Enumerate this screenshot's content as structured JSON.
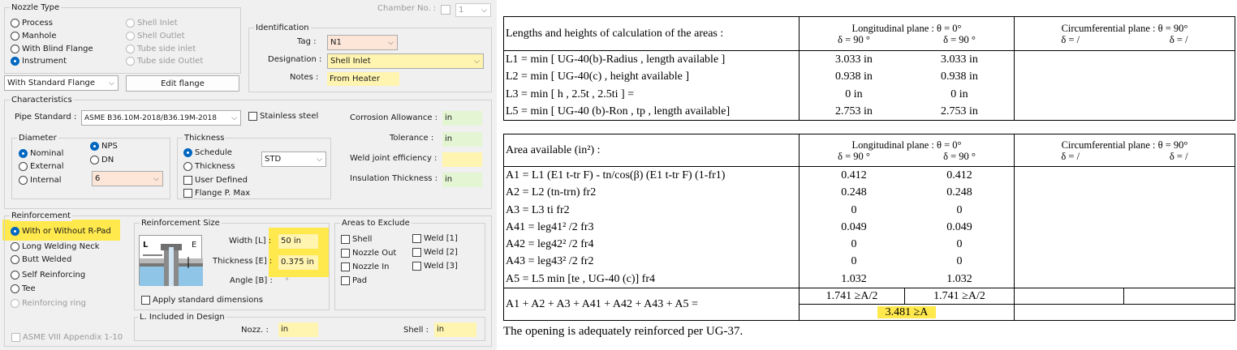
{
  "nozzle_type": {
    "title": "Nozzle Type",
    "options": [
      "Process",
      "Manhole",
      "With Blind Flange",
      "Instrument"
    ],
    "selected": "Instrument",
    "disabled_options": [
      "Shell Inlet",
      "Shell Outlet",
      "Tube side inlet",
      "Tube side Outlet"
    ]
  },
  "chamber": {
    "label": "Chamber No. :",
    "value": "1"
  },
  "identification": {
    "title": "Identification",
    "tag_label": "Tag :",
    "tag_value": "N1",
    "designation_label": "Designation :",
    "designation_value": "Shell Inlet",
    "notes_label": "Notes :",
    "notes_value": "From Heater"
  },
  "flange": {
    "select_value": "With Standard Flange",
    "edit_button": "Edit flange"
  },
  "characteristics": {
    "title": "Characteristics",
    "pipe_standard_label": "Pipe Standard :",
    "pipe_standard_value": "ASME B36.10M-2018/B36.19M-2018",
    "stainless_label": "Stainless steel",
    "corrosion_label": "Corrosion Allowance :",
    "corrosion_value": "in",
    "tolerance_label": "Tolerance :",
    "tolerance_value": "in",
    "weld_eff_label": "Weld joint efficiency :",
    "weld_eff_value": "",
    "insulation_label": "Insulation Thickness :",
    "insulation_value": "in"
  },
  "diameter": {
    "title": "Diameter",
    "options": [
      "Nominal",
      "External",
      "Internal"
    ],
    "selected": "Nominal",
    "unit_options": [
      "NPS",
      "DN"
    ],
    "unit_selected": "NPS",
    "size_value": "6"
  },
  "thickness": {
    "title": "Thickness",
    "options": [
      "Schedule",
      "Thickness"
    ],
    "selected": "Schedule",
    "schedule_value": "STD",
    "user_defined_label": "User Defined",
    "flange_max_label": "Flange P. Max"
  },
  "reinforcement": {
    "title": "Reinforcement",
    "options": [
      "With or Without R-Pad",
      "Long Welding Neck",
      "Butt Welded",
      "Self Reinforcing",
      "Tee"
    ],
    "selected": "With or Without R-Pad",
    "disabled_option": "Reinforcing ring",
    "appendix_label": "ASME VIII Appendix 1-10"
  },
  "reinforcement_size": {
    "title": "Reinforcement Size",
    "width_label": "Width [L] :",
    "width_value": "50 in",
    "thickness_label": "Thickness [E] :",
    "thickness_value": "0.375 in",
    "angle_label": "Angle [B] :",
    "angle_value": "°",
    "apply_std_label": "Apply standard dimensions",
    "diagram_L": "L",
    "diagram_E": "E"
  },
  "areas_exclude": {
    "title": "Areas to Exclude",
    "col1": [
      "Shell",
      "Nozzle Out",
      "Nozzle In",
      "Pad"
    ],
    "col2": [
      "Weld [1]",
      "Weld [2]",
      "Weld [3]"
    ]
  },
  "included": {
    "title": "L. Included in Design",
    "nozz_label": "Nozz. :",
    "nozz_value": "in",
    "shell_label": "Shell :",
    "shell_value": "in"
  },
  "table1": {
    "head": "Lengths and heights of calculation of the areas :",
    "long_plane": "Longitudinal plane : θ = 0°",
    "circ_plane": "Circumferential plane : θ = 90°",
    "d_long1": "δ = 90 °",
    "d_long2": "δ = 90 °",
    "d_circ1": "δ = /",
    "d_circ2": "δ = /",
    "rows": [
      {
        "label": "L1 = min [ UG-40(b)-Radius , length available ]",
        "v1": "3.033 in",
        "v2": "3.033 in"
      },
      {
        "label": "L2 = min [ UG-40(c) , height available ]",
        "v1": "0.938 in",
        "v2": "0.938 in"
      },
      {
        "label": "L3 = min [ h , 2.5t , 2.5ti ] =",
        "v1": "0 in",
        "v2": "0 in"
      },
      {
        "label": "L5 = min [ UG-40 (b)-Ron , tp , length available]",
        "v1": "2.753 in",
        "v2": "2.753 in"
      }
    ]
  },
  "table2": {
    "head": "Area available (in²) :",
    "long_plane": "Longitudinal plane : θ = 0°",
    "circ_plane": "Circumferential plane : θ = 90°",
    "d_long1": "δ = 90 °",
    "d_long2": "δ = 90 °",
    "d_circ1": "δ = /",
    "d_circ2": "δ = /",
    "rows": [
      {
        "label": "A1 = L1 (E1 t-tr F) - tn/cos(β) (E1 t-tr F) (1-fr1)",
        "v1": "0.412",
        "v2": "0.412"
      },
      {
        "label": "A2 = L2 (tn-trn) fr2",
        "v1": "0.248",
        "v2": "0.248"
      },
      {
        "label": "A3 = L3 ti fr2",
        "v1": "0",
        "v2": "0"
      },
      {
        "label": "A41 = leg41² /2 fr3",
        "v1": "0.049",
        "v2": "0.049"
      },
      {
        "label": "A42 = leg42² /2 fr4",
        "v1": "0",
        "v2": "0"
      },
      {
        "label": "A43 = leg43² /2 fr2",
        "v1": "0",
        "v2": "0"
      },
      {
        "label": "A5 = L5 min [te , UG-40 (c)] fr4",
        "v1": "1.032",
        "v2": "1.032"
      }
    ],
    "sum_label": "A1 + A2 + A3 + A41 + A42 + A43 + A5 =",
    "half1": "1.741 ≥A/2",
    "half2": "1.741 ≥A/2",
    "total": "3.481 ≥A"
  },
  "conclusion": "The opening is adequately reinforced per UG-37.",
  "colors": {
    "highlight": "#ffe94d",
    "field_pink": "#fde6d8",
    "field_yellow": "#fff4b0",
    "field_green": "#e4f5d4",
    "radio_on": "#0067c0"
  }
}
